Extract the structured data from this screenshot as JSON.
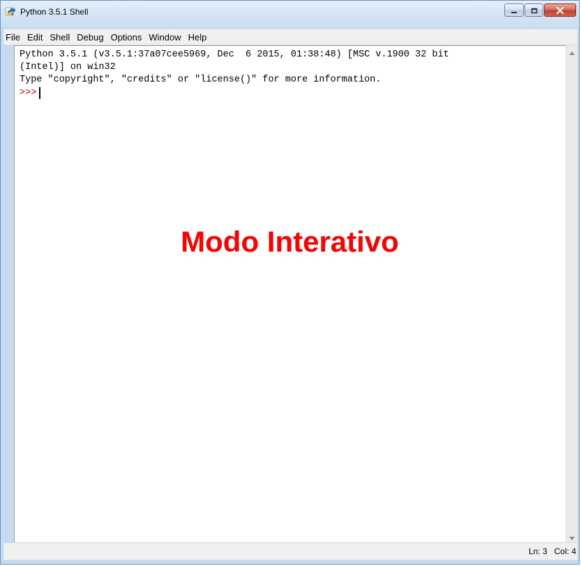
{
  "window": {
    "title": "Python 3.5.1 Shell",
    "icon": "python-idle-icon",
    "controls": [
      "minimize-icon",
      "maximize-icon",
      "close-icon"
    ]
  },
  "menu": {
    "items": [
      "File",
      "Edit",
      "Shell",
      "Debug",
      "Options",
      "Window",
      "Help"
    ]
  },
  "shell": {
    "lines": [
      "Python 3.5.1 (v3.5.1:37a07cee5969, Dec  6 2015, 01:38:48) [MSC v.1900 32 bit",
      "(Intel)] on win32",
      "Type \"copyright\", \"credits\" or \"license()\" for more information."
    ],
    "prompt": ">>>",
    "prompt_color": "#c00000"
  },
  "overlay": {
    "text": "Modo Interativo",
    "color": "#ff0000"
  },
  "status": {
    "line": "Ln: 3",
    "col": "Col: 4"
  }
}
